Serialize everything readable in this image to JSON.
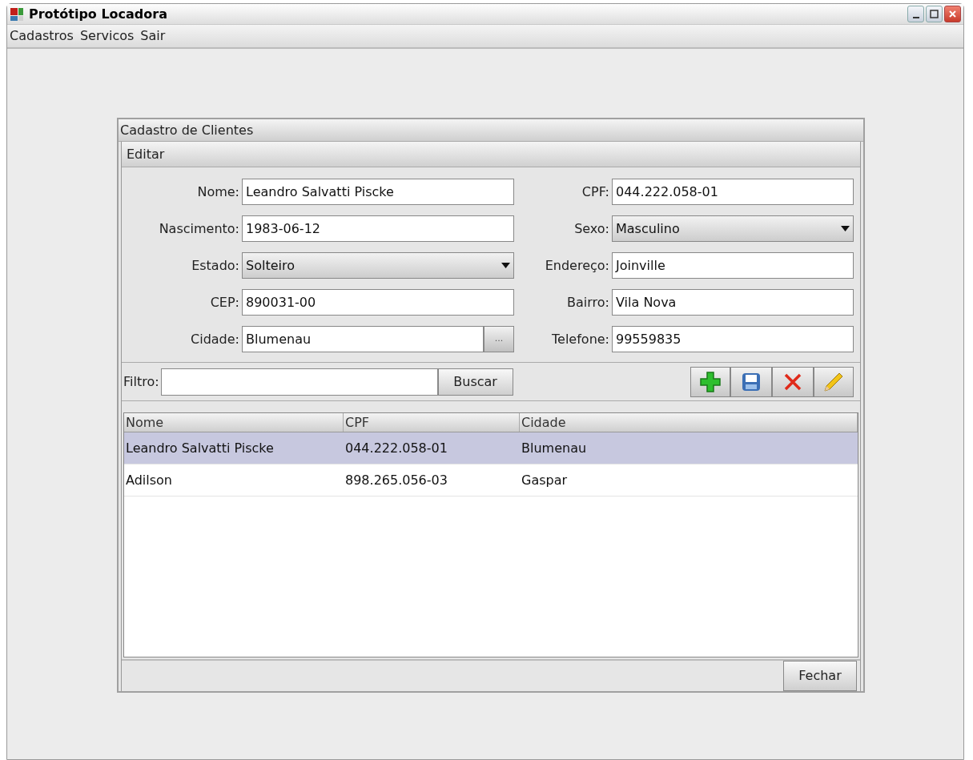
{
  "window": {
    "title": "Protótipo Locadora"
  },
  "menu": [
    "Cadastros",
    "Servicos",
    "Sair"
  ],
  "dialog": {
    "title": "Cadastro de Clientes",
    "section": "Editar",
    "fields": [
      {
        "label": "Nome:",
        "kind": "text",
        "value": "Leandro Salvatti Piscke"
      },
      {
        "label": "CPF:",
        "kind": "text",
        "value": "044.222.058-01"
      },
      {
        "label": "Nascimento:",
        "kind": "text",
        "value": "1983-06-12"
      },
      {
        "label": "Sexo:",
        "kind": "combo",
        "value": "Masculino"
      },
      {
        "label": "Estado:",
        "kind": "combo",
        "value": "Solteiro"
      },
      {
        "label": "Endereço:",
        "kind": "text",
        "value": "Joinville"
      },
      {
        "label": "CEP:",
        "kind": "text",
        "value": "890031-00"
      },
      {
        "label": "Bairro:",
        "kind": "text",
        "value": "Vila Nova"
      },
      {
        "label": "Cidade:",
        "kind": "lookup",
        "value": "Blumenau",
        "button": "..."
      },
      {
        "label": "Telefone:",
        "kind": "text",
        "value": "99559835"
      }
    ],
    "filter": {
      "label": "Filtro:",
      "button": "Buscar"
    },
    "table": {
      "columns": [
        "Nome",
        "CPF",
        "Cidade"
      ],
      "rows": [
        {
          "cells": [
            "Leandro Salvatti Piscke",
            "044.222.058-01",
            "Blumenau"
          ],
          "selected": true
        },
        {
          "cells": [
            "Adilson",
            "898.265.056-03",
            "Gaspar"
          ],
          "selected": false
        }
      ]
    },
    "close_button": "Fechar"
  }
}
